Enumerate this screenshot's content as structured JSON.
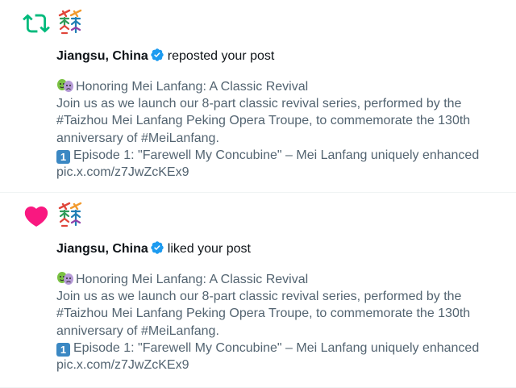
{
  "notifications": [
    {
      "type_icon": "repost-icon",
      "user": "Jiangsu, China",
      "action": "reposted your post",
      "post": {
        "line1": "Honoring Mei Lanfang: A Classic Revival",
        "line2": "Join us as we launch our 8-part classic revival series, performed by the",
        "line3": "#Taizhou Mei Lanfang Peking Opera Troupe, to commemorate the 130th",
        "line4": "anniversary of #MeiLanfang.",
        "keycap": "1",
        "line5": "Episode 1: \"Farewell My Concubine\" – Mei Lanfang uniquely enhanced",
        "link": "pic.x.com/z7JwZcKEx9"
      }
    },
    {
      "type_icon": "heart-icon",
      "user": "Jiangsu, China",
      "action": "liked your post",
      "post": {
        "line1": "Honoring Mei Lanfang: A Classic Revival",
        "line2": "Join us as we launch our 8-part classic revival series, performed by the",
        "line3": "#Taizhou Mei Lanfang Peking Opera Troupe, to commemorate the 130th",
        "line4": "anniversary of #MeiLanfang.",
        "keycap": "1",
        "line5": "Episode 1: \"Farewell My Concubine\" – Mei Lanfang uniquely enhanced",
        "link": "pic.x.com/z7JwZcKEx9"
      }
    }
  ],
  "colors": {
    "repost": "#00ba7c",
    "like": "#f91880",
    "verified": "#1d9bf0",
    "text": "#0f1419",
    "secondary_text": "#536471"
  }
}
